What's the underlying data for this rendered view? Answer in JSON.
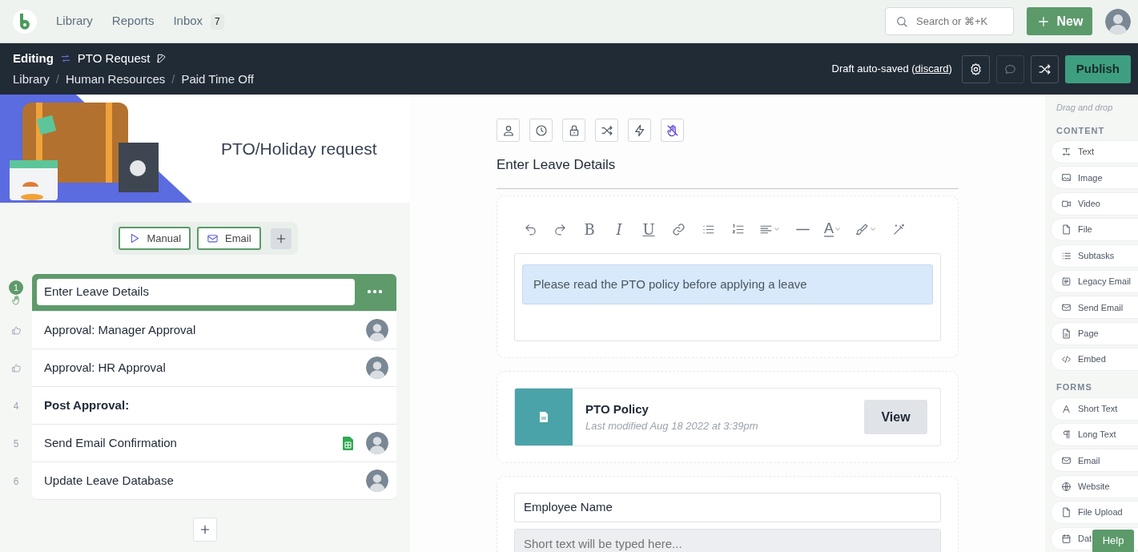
{
  "topnav": {
    "nav_items": [
      {
        "label": "Library"
      },
      {
        "label": "Reports"
      },
      {
        "label": "Inbox",
        "badge": "7"
      }
    ],
    "search": {
      "placeholder": "Search or ⌘+K"
    },
    "new_button": "New"
  },
  "editor_bar": {
    "mode": "Editing",
    "title": "PTO Request",
    "breadcrumbs": [
      "Library",
      "Human Resources",
      "Paid Time Off"
    ],
    "breadcrumb_separators": [
      "/",
      "/"
    ],
    "draft_prefix": "Draft auto-saved (",
    "discard_link": "discard",
    "draft_suffix": ")",
    "publish_button": "Publish"
  },
  "workflow": {
    "title": "PTO/Holiday request",
    "triggers": [
      {
        "label": "Manual",
        "kind": "manual"
      },
      {
        "label": "Email",
        "kind": "email"
      }
    ],
    "tasks": [
      {
        "kind": "form",
        "number": "1",
        "title": "Enter Leave Details",
        "selected": true,
        "assigned": false,
        "sheet": false
      },
      {
        "kind": "approval",
        "title": "Approval: Manager Approval",
        "selected": false,
        "assigned": true,
        "sheet": false
      },
      {
        "kind": "approval",
        "title": "Approval: HR Approval",
        "selected": false,
        "assigned": true,
        "sheet": false
      },
      {
        "kind": "heading",
        "number": "4",
        "title": "Post Approval:",
        "selected": false,
        "assigned": false,
        "sheet": false
      },
      {
        "kind": "task",
        "number": "5",
        "title": "Send Email Confirmation",
        "selected": false,
        "assigned": true,
        "sheet": true
      },
      {
        "kind": "task",
        "number": "6",
        "title": "Update Leave Database",
        "selected": false,
        "assigned": true,
        "sheet": false
      }
    ]
  },
  "step": {
    "title": "Enter Leave Details",
    "format_buttons": [
      {
        "glyph": "B",
        "kind": "bold"
      },
      {
        "glyph": "I",
        "kind": "italic"
      },
      {
        "glyph": "U",
        "kind": "underline"
      }
    ],
    "color_button": "A",
    "notice": "Please read the PTO policy before applying a leave",
    "file": {
      "name": "PTO Policy",
      "modified": "Last modified Aug 18 2022 at 3:39pm",
      "button": "View"
    },
    "field": {
      "label": "Employee Name",
      "placeholder": "Short text will be typed here..."
    }
  },
  "palette": {
    "hint": "Drag and drop",
    "groups": [
      {
        "title": "CONTENT",
        "items": [
          {
            "label": "Text",
            "kind": "text"
          },
          {
            "label": "Image",
            "kind": "image"
          },
          {
            "label": "Video",
            "kind": "video"
          },
          {
            "label": "File",
            "kind": "file"
          },
          {
            "label": "Subtasks",
            "kind": "list"
          },
          {
            "label": "Legacy Email",
            "kind": "legacy"
          },
          {
            "label": "Send Email",
            "kind": "mail"
          },
          {
            "label": "Page",
            "kind": "page"
          },
          {
            "label": "Embed",
            "kind": "code"
          }
        ]
      },
      {
        "title": "FORMS",
        "items": [
          {
            "label": "Short Text",
            "kind": "font"
          },
          {
            "label": "Long Text",
            "kind": "pilcrow"
          },
          {
            "label": "Email",
            "kind": "mail"
          },
          {
            "label": "Website",
            "kind": "globe"
          },
          {
            "label": "File Upload",
            "kind": "file"
          },
          {
            "label": "Dat",
            "kind": "calendar"
          }
        ]
      }
    ]
  },
  "help_button": "Help"
}
